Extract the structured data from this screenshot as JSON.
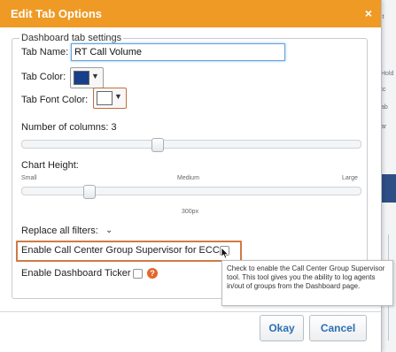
{
  "dialog": {
    "title": "Edit Tab Options",
    "close_glyph": "×"
  },
  "settings": {
    "legend": "Dashboard tab settings",
    "tab_name_label": "Tab Name:",
    "tab_name_value": "RT Call Volume",
    "tab_color_label": "Tab Color:",
    "tab_color_value": "#173f8a",
    "tab_font_color_label": "Tab Font Color:",
    "tab_font_color_value": "#ffffff",
    "columns_label": "Number of columns: 3",
    "columns_slider_fraction": 0.4,
    "chart_height_label": "Chart Height:",
    "chart_height_small": "Small",
    "chart_height_medium": "Medium",
    "chart_height_large": "Large",
    "chart_height_value": "300px",
    "chart_height_slider_fraction": 0.2,
    "replace_filters_label": "Replace all filters:",
    "ecc_label": "Enable Call Center Group Supervisor for ECC",
    "ticker_label": "Enable Dashboard Ticker",
    "help_glyph": "?"
  },
  "tooltip": {
    "text": "Check to enable the Call Center Group Supervisor tool. This tool gives you the ability to log agents in/out of groups from the Dashboard page."
  },
  "buttons": {
    "okay": "Okay",
    "cancel": "Cancel"
  },
  "background_page": {
    "fragments": [
      "lt",
      "Hold",
      "tc",
      "ab",
      "ar"
    ]
  },
  "colors": {
    "title_bar": "#ee9a25",
    "highlight_border": "#d07a45",
    "button_text": "#2e6fb3",
    "help_icon": "#e2672b"
  }
}
